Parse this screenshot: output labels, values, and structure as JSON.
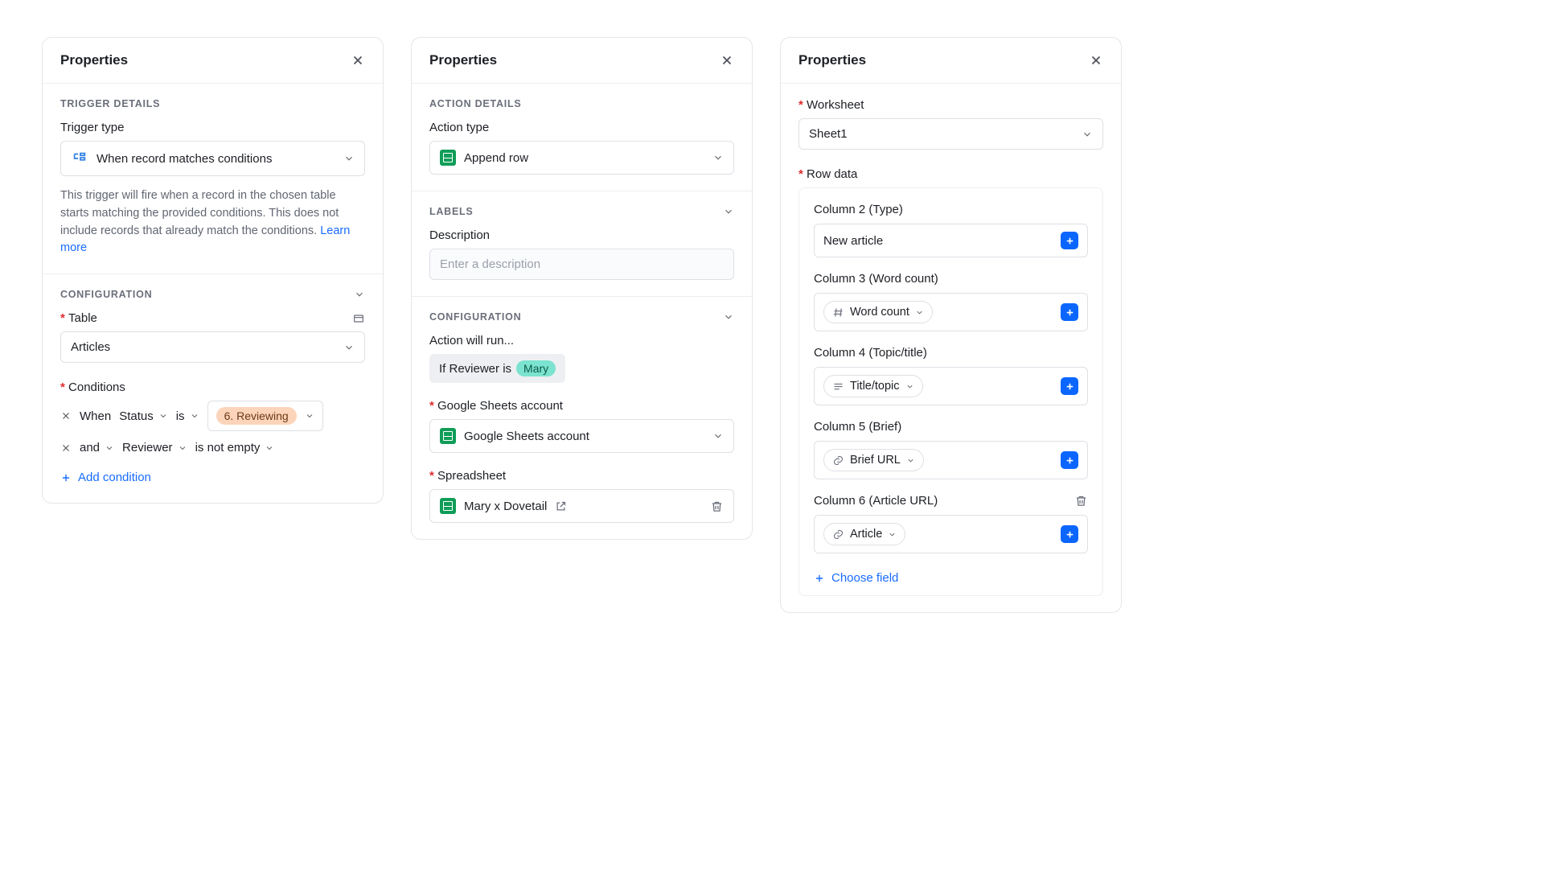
{
  "panel1": {
    "title": "Properties",
    "trigger_section": "TRIGGER DETAILS",
    "trigger_type_label": "Trigger type",
    "trigger_type_value": "When record matches conditions",
    "trigger_help": "This trigger will fire when a record in the chosen table starts matching the provided conditions. This does not include records that already match the conditions. ",
    "learn_more": "Learn more",
    "config_section": "CONFIGURATION",
    "table_label": "Table",
    "table_value": "Articles",
    "conditions_label": "Conditions",
    "cond1_when": "When",
    "cond1_field": "Status",
    "cond1_op": "is",
    "cond1_value": "6. Reviewing",
    "cond2_join": "and",
    "cond2_field": "Reviewer",
    "cond2_op": "is not empty",
    "add_condition": "Add condition"
  },
  "panel2": {
    "title": "Properties",
    "action_section": "ACTION DETAILS",
    "action_type_label": "Action type",
    "action_type_value": "Append row",
    "labels_section": "LABELS",
    "description_label": "Description",
    "description_placeholder": "Enter a description",
    "config_section": "CONFIGURATION",
    "run_label": "Action will run...",
    "run_prefix": "If Reviewer is",
    "run_tag": "Mary",
    "gs_account_label": "Google Sheets account",
    "gs_account_value": "Google Sheets account",
    "spreadsheet_label": "Spreadsheet",
    "spreadsheet_value": "Mary x Dovetail"
  },
  "panel3": {
    "title": "Properties",
    "worksheet_label": "Worksheet",
    "worksheet_value": "Sheet1",
    "rowdata_label": "Row data",
    "rows": [
      {
        "label": "Column 2 (Type)",
        "text": "New article",
        "kind": "text"
      },
      {
        "label": "Column 3 (Word count)",
        "token": "Word count",
        "kind": "number"
      },
      {
        "label": "Column 4 (Topic/title)",
        "token": "Title/topic",
        "kind": "text-lines"
      },
      {
        "label": "Column 5 (Brief)",
        "token": "Brief URL",
        "kind": "link"
      },
      {
        "label": "Column 6 (Article URL)",
        "token": "Article",
        "kind": "link",
        "deletable": true
      }
    ],
    "choose_field": "Choose field"
  }
}
